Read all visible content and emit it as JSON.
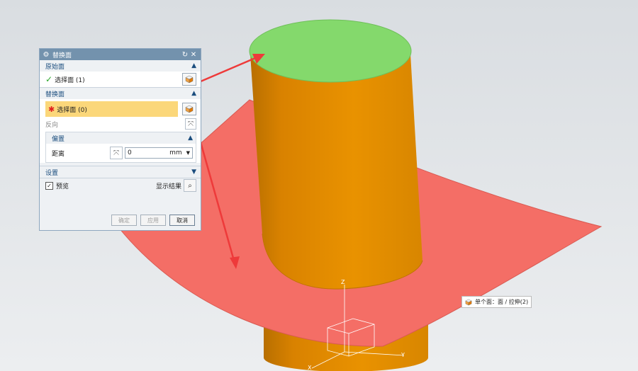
{
  "dialog": {
    "title": "替换面",
    "icons": {
      "title": "gear-icon",
      "reset": "reset-icon",
      "close": "close-icon"
    },
    "original_face": {
      "header": "原始面",
      "select_label": "选择面 (1)"
    },
    "replacement_face": {
      "header": "替换面",
      "select_label": "选择面 (0)",
      "reverse_label": "反向",
      "offset": {
        "header": "偏置",
        "distance_label": "距离",
        "distance_value": "0",
        "unit": "mm"
      }
    },
    "settings": {
      "header": "设置"
    },
    "preview_label": "预览",
    "show_result_label": "显示结果",
    "buttons": {
      "ok": "确定",
      "apply": "应用",
      "cancel": "取消"
    }
  },
  "tooltip": {
    "text": "单个面：面 / 拉伸(2)"
  },
  "axes": {
    "x": "X",
    "y": "Y",
    "z": "Z"
  },
  "colors": {
    "cylinder": "#e08a00",
    "top_face": "#84d96c",
    "surface": "#f46e66",
    "arrow": "#ee3a3a",
    "titlebar": "#7392ad",
    "highlight": "#fbd77a"
  }
}
